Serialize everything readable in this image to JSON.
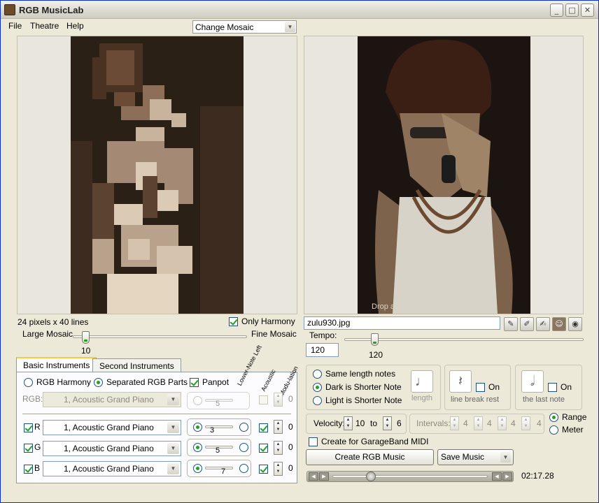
{
  "window": {
    "title": "RGB MusicLab",
    "minimize": "_",
    "maximize": "□",
    "close": "✕"
  },
  "menu": [
    "File",
    "Theatre",
    "Help"
  ],
  "mosaic_select": {
    "value": "Change Mosaic"
  },
  "left": {
    "pixel_info": "24 pixels x 40 lines",
    "only_harmony": {
      "label": "Only Harmony",
      "checked": true
    },
    "large_mosaic": "Large Mosaic",
    "fine_mosaic": "Fine Mosaic",
    "mosaic_value": "10",
    "mosaic_level": 0.1
  },
  "tabs": [
    "Basic Instruments",
    "Second Instruments"
  ],
  "instruments": {
    "rgb_harmony": "RGB Harmony",
    "separated": "Separated RGB Parts",
    "panpot": "Panpot",
    "rotated_headers": [
      "Lower-Note Left",
      "Acoustic",
      "Modu-lation"
    ],
    "rgb_label": "RGB:",
    "rgb_instrument": "1, Acoustic Grand Piano",
    "rgb_pan": "5",
    "rgb_mod": "0",
    "rows": [
      {
        "channel": "R",
        "instrument": "1, Acoustic Grand Piano",
        "pan": "3",
        "mod": "0"
      },
      {
        "channel": "G",
        "instrument": "1, Acoustic Grand Piano",
        "pan": "5",
        "mod": "0"
      },
      {
        "channel": "B",
        "instrument": "1, Acoustic Grand Piano",
        "pan": "7",
        "mod": "0"
      }
    ]
  },
  "right": {
    "overlay_text": "Drop an Image here or Click here.",
    "filename": "zulu930.jpg",
    "tempo_label": "Tempo:",
    "tempo_value": "120",
    "tempo_tick": "120",
    "note_options": [
      "Same length notes",
      "Dark is Shorter Note",
      "Light is Shorter Note"
    ],
    "length_label": "length",
    "line_break_label": "line break rest",
    "last_note_label": "the last note",
    "on_label": "On",
    "velocity_label": "Velocity:",
    "velocity_from": "10",
    "to_label": "to",
    "velocity_to": "6",
    "intervals_label": "Intervals:",
    "intervals": [
      "4",
      "4",
      "4",
      "4"
    ],
    "range_label": "Range",
    "meter_label": "Meter",
    "garageband_label": "Create for GarageBand MIDI",
    "create_button": "Create RGB Music",
    "save_button": "Save Music",
    "time": "02:17.28"
  },
  "icons": {
    "toolbar": [
      "edit-image-icon",
      "paint-icon",
      "brush-icon",
      "face-icon",
      "camera-icon"
    ],
    "player": [
      "prev-icon",
      "play-icon",
      "rewind-icon",
      "forward-icon"
    ]
  }
}
